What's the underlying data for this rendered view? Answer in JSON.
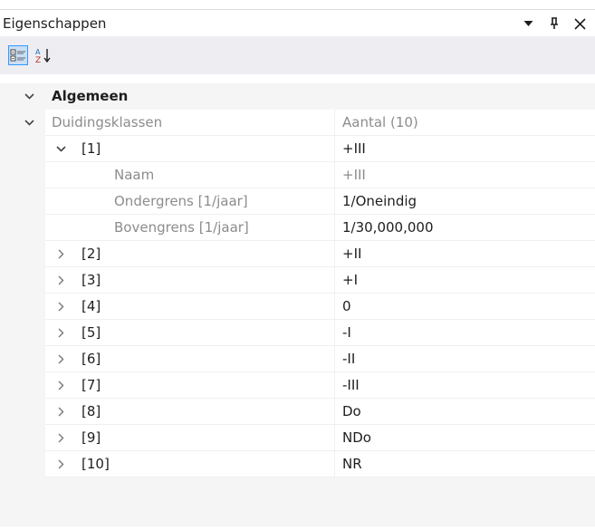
{
  "panel": {
    "title": "Eigenschappen"
  },
  "rows": [
    {
      "name": "Algemeen",
      "value": ""
    },
    {
      "name": "Duidingsklassen",
      "value": "Aantal (10)"
    },
    {
      "name": "[1]",
      "value": "+III"
    },
    {
      "name": "Naam",
      "value": "+III"
    },
    {
      "name": "Ondergrens [1/jaar]",
      "value": "1/Oneindig"
    },
    {
      "name": "Bovengrens [1/jaar]",
      "value": "1/30,000,000"
    },
    {
      "name": "[2]",
      "value": "+II"
    },
    {
      "name": "[3]",
      "value": "+I"
    },
    {
      "name": "[4]",
      "value": "0"
    },
    {
      "name": "[5]",
      "value": "-I"
    },
    {
      "name": "[6]",
      "value": "-II"
    },
    {
      "name": "[7]",
      "value": "-III"
    },
    {
      "name": "[8]",
      "value": "Do"
    },
    {
      "name": "[9]",
      "value": "NDo"
    },
    {
      "name": "[10]",
      "value": "NR"
    }
  ]
}
